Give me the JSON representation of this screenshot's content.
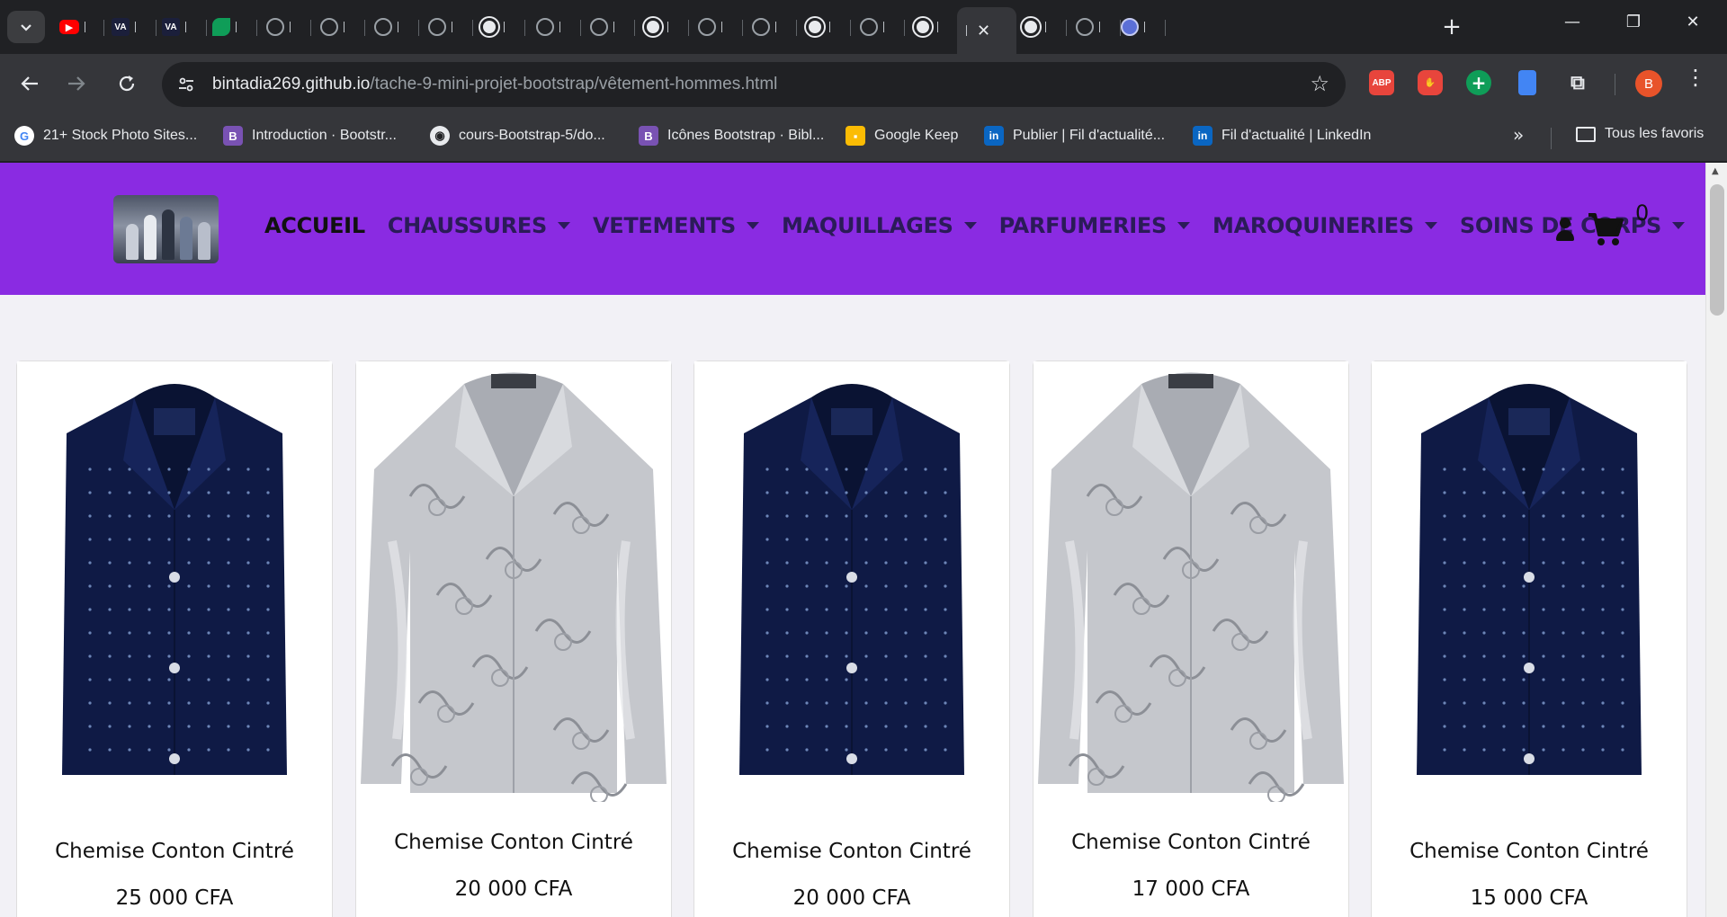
{
  "browser": {
    "tabs": [
      {
        "icon": "youtube-icon"
      },
      {
        "icon": "va-icon"
      },
      {
        "icon": "va-icon"
      },
      {
        "icon": "leaf-icon"
      },
      {
        "icon": "globe-icon"
      },
      {
        "icon": "globe-icon"
      },
      {
        "icon": "globe-icon"
      },
      {
        "icon": "globe-icon"
      },
      {
        "icon": "github-icon"
      },
      {
        "icon": "globe-icon"
      },
      {
        "icon": "globe-icon"
      },
      {
        "icon": "github-icon"
      },
      {
        "icon": "globe-icon"
      },
      {
        "icon": "globe-icon"
      },
      {
        "icon": "github-icon"
      },
      {
        "icon": "globe-icon"
      },
      {
        "icon": "github-icon"
      },
      {
        "icon": "active-tab",
        "close": "✕"
      },
      {
        "icon": "github-icon"
      },
      {
        "icon": "globe-icon"
      },
      {
        "icon": "copilot-icon"
      }
    ],
    "new_tab": "+",
    "address": {
      "host": "bintadia269.github.io",
      "path": "/tache-9-mini-projet-bootstrap/vêtement-hommes.html"
    },
    "extensions": [
      {
        "name": "adblock-plus-icon",
        "label": "ABP"
      },
      {
        "name": "stop-hand-icon",
        "label": ""
      },
      {
        "name": "plus-extension-icon",
        "label": "+"
      },
      {
        "name": "docs-extension-icon",
        "label": ""
      },
      {
        "name": "extensions-puzzle-icon",
        "label": "⧉"
      }
    ],
    "profile_initial": "B",
    "bookmarks": [
      {
        "icon": "G",
        "kind": "g",
        "label": "21+ Stock Photo Sites..."
      },
      {
        "icon": "B",
        "kind": "b",
        "label": "Introduction · Bootstr..."
      },
      {
        "icon": "◉",
        "kind": "gh",
        "label": "cours-Bootstrap-5/do..."
      },
      {
        "icon": "B",
        "kind": "b",
        "label": "Icônes Bootstrap · Bibl..."
      },
      {
        "icon": "▪",
        "kind": "keep",
        "label": "Google Keep"
      },
      {
        "icon": "in",
        "kind": "li",
        "label": "Publier | Fil d'actualité..."
      },
      {
        "icon": "in",
        "kind": "li",
        "label": "Fil d'actualité | LinkedIn"
      }
    ],
    "bookmarks_more": "»",
    "all_bookmarks": "Tous les favoris"
  },
  "site": {
    "colors": {
      "navbar": "#8a2be2",
      "link": "#2b1b58",
      "active": "#111111"
    },
    "nav": [
      {
        "label": "ACCUEIL",
        "dropdown": false
      },
      {
        "label": "CHAUSSURES",
        "dropdown": true
      },
      {
        "label": "VETEMENTS",
        "dropdown": true
      },
      {
        "label": "MAQUILLAGES",
        "dropdown": true
      },
      {
        "label": "PARFUMERIES",
        "dropdown": true
      },
      {
        "label": "MAROQUINERIES",
        "dropdown": true
      },
      {
        "label": "SOINS DE CORPS",
        "dropdown": true
      }
    ],
    "cart_count": "0"
  },
  "products": [
    {
      "title": "Chemise Conton Cintré",
      "price": "25 000 CFA",
      "image": "navy-dotted-shirt"
    },
    {
      "title": "Chemise Conton Cintré",
      "price": "20 000 CFA",
      "image": "silver-paisley-shirt"
    },
    {
      "title": "Chemise Conton Cintré",
      "price": "20 000 CFA",
      "image": "navy-dotted-shirt"
    },
    {
      "title": "Chemise Conton Cintré",
      "price": "17 000 CFA",
      "image": "silver-paisley-shirt"
    },
    {
      "title": "Chemise Conton Cintré",
      "price": "15 000 CFA",
      "image": "navy-dotted-shirt"
    }
  ]
}
